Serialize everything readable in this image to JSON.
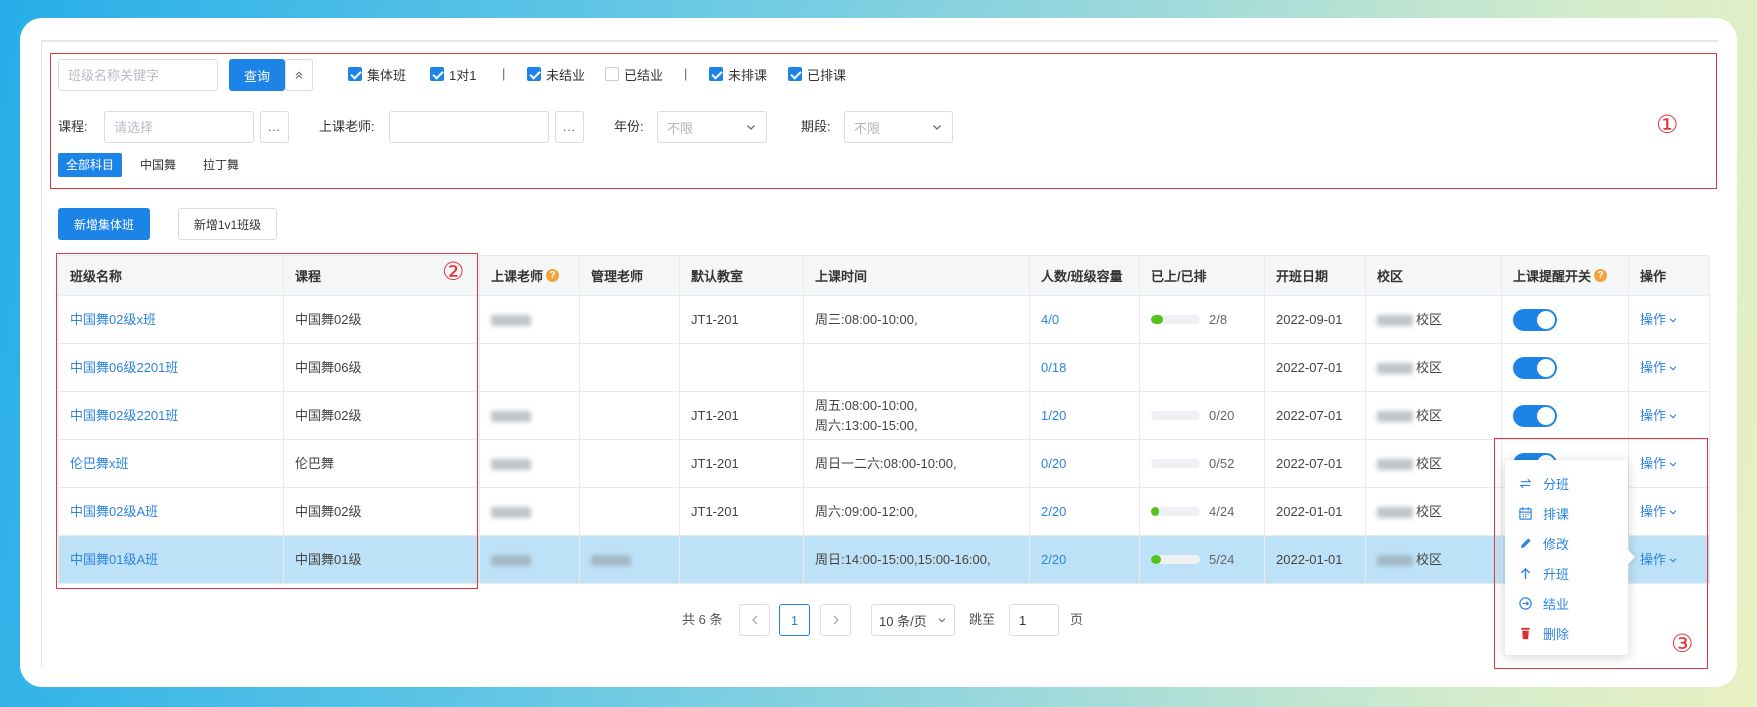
{
  "colors": {
    "primary": "#1c84e6",
    "link": "#2d84e0",
    "success": "#52c41a",
    "danger": "#e02b35",
    "highlight_row": "#bde2f7",
    "annotation": "#e2363c",
    "help_icon": "#f0a23b"
  },
  "filters": {
    "search": {
      "placeholder": "班级名称关键字"
    },
    "query_button": "查询",
    "collapse_icon": "double-chevron-up-icon",
    "checkboxes": [
      {
        "label": "集体班",
        "checked": true
      },
      {
        "label": "1对1",
        "checked": true
      },
      {
        "label": "未结业",
        "checked": true
      },
      {
        "label": "已结业",
        "checked": false
      },
      {
        "label": "未排课",
        "checked": true
      },
      {
        "label": "已排课",
        "checked": true
      }
    ],
    "separator": "|",
    "course": {
      "label": "课程:",
      "placeholder": "请选择",
      "picker": "..."
    },
    "teacher": {
      "label": "上课老师:",
      "picker": "..."
    },
    "year": {
      "label": "年份:",
      "value": "不限"
    },
    "period": {
      "label": "期段:",
      "value": "不限"
    },
    "subjects": [
      {
        "label": "全部科目",
        "active": true
      },
      {
        "label": "中国舞",
        "active": false
      },
      {
        "label": "拉丁舞",
        "active": false
      }
    ]
  },
  "actions": {
    "add_group_class": "新增集体班",
    "add_1v1_class": "新增1v1班级"
  },
  "table": {
    "columns": [
      {
        "label": "班级名称"
      },
      {
        "label": "课程"
      },
      {
        "label": "上课老师",
        "icon": "help-icon"
      },
      {
        "label": "管理老师"
      },
      {
        "label": "默认教室"
      },
      {
        "label": "上课时间"
      },
      {
        "label": "人数/班级容量"
      },
      {
        "label": "已上/已排"
      },
      {
        "label": "开班日期"
      },
      {
        "label": "校区"
      },
      {
        "label": "上课提醒开关",
        "icon": "help-icon"
      },
      {
        "label": "操作"
      }
    ],
    "rows": [
      {
        "name": "中国舞02级x班",
        "course": "中国舞02级",
        "teacher_blurred": true,
        "room": "JT1-201",
        "time": [
          "周三:08:00-10:00,"
        ],
        "capacity": "4/0",
        "progress_text": "2/8",
        "progress": 0.25,
        "start_date": "2022-09-01",
        "campus": "校区",
        "reminder": true,
        "action": "操作"
      },
      {
        "name": "中国舞06级2201班",
        "course": "中国舞06级",
        "capacity": "0/18",
        "start_date": "2022-07-01",
        "campus": "校区",
        "reminder": true,
        "action": "操作"
      },
      {
        "name": "中国舞02级2201班",
        "course": "中国舞02级",
        "teacher_blurred": true,
        "room": "JT1-201",
        "time": [
          "周五:08:00-10:00,",
          "周六:13:00-15:00,"
        ],
        "capacity": "1/20",
        "progress_text": "0/20",
        "progress": 0,
        "start_date": "2022-07-01",
        "campus": "校区",
        "reminder": true,
        "action": "操作"
      },
      {
        "name": "伦巴舞x班",
        "course": "伦巴舞",
        "teacher_blurred": true,
        "room": "JT1-201",
        "time": [
          "周日一二六:08:00-10:00,"
        ],
        "capacity": "0/20",
        "progress_text": "0/52",
        "progress": 0,
        "start_date": "2022-07-01",
        "campus": "校区",
        "reminder": true,
        "action": "操作"
      },
      {
        "name": "中国舞02级A班",
        "course": "中国舞02级",
        "teacher_blurred": true,
        "room": "JT1-201",
        "time": [
          "周六:09:00-12:00,"
        ],
        "capacity": "2/20",
        "progress_text": "4/24",
        "progress": 0.17,
        "start_date": "2022-01-01",
        "campus": "校区",
        "reminder": true,
        "action": "操作"
      },
      {
        "name": "中国舞01级A班",
        "course": "中国舞01级",
        "teacher_blurred": true,
        "manager_blurred": true,
        "time": [
          "周日:14:00-15:00,15:00-16:00,"
        ],
        "capacity": "2/20",
        "progress_text": "5/24",
        "progress": 0.21,
        "start_date": "2022-01-01",
        "campus": "校区",
        "reminder": true,
        "action": "操作",
        "highlighted": true
      }
    ]
  },
  "row_menu": {
    "items": [
      {
        "icon": "swap-icon",
        "label": "分班"
      },
      {
        "icon": "calendar-icon",
        "label": "排课"
      },
      {
        "icon": "edit-icon",
        "label": "修改"
      },
      {
        "icon": "arrow-up-icon",
        "label": "升班"
      },
      {
        "icon": "exit-icon",
        "label": "结业"
      },
      {
        "icon": "trash-icon",
        "label": "删除"
      }
    ]
  },
  "pagination": {
    "total": "共 6 条",
    "current_page": "1",
    "page_size": "10 条/页",
    "jump_label": "跳至",
    "jump_value": "1",
    "page_suffix": "页"
  },
  "annotations": {
    "one": "①",
    "two": "②",
    "three": "③"
  }
}
